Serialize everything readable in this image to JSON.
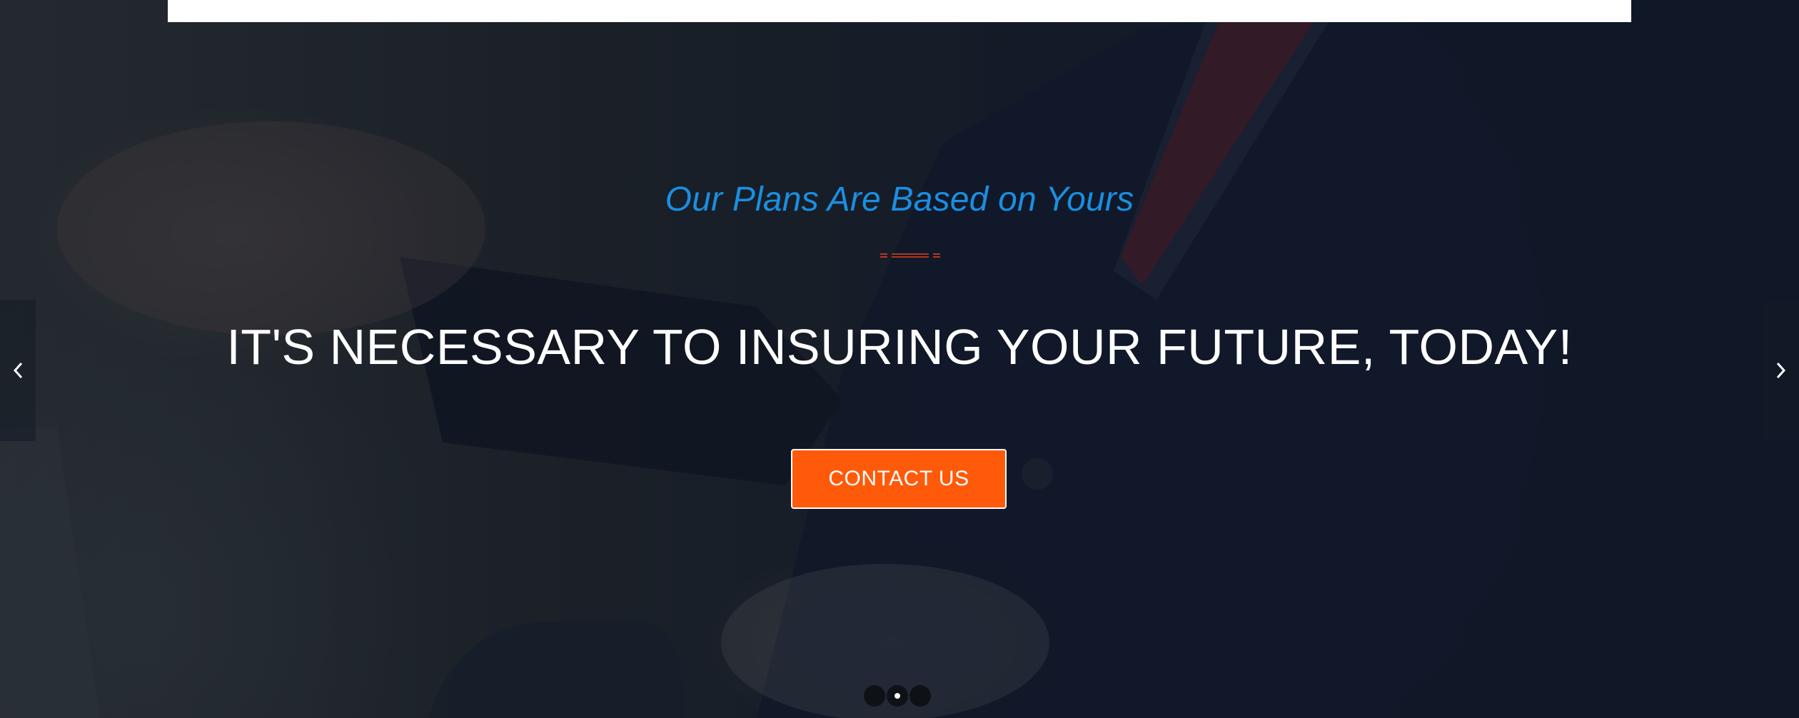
{
  "hero": {
    "subtitle": "Our Plans Are Based on Yours",
    "headline": "IT'S NECESSARY TO INSURING YOUR FUTURE, TODAY!",
    "cta_label": "CONTACT US"
  },
  "slider": {
    "prev_icon": "chevron-left-icon",
    "next_icon": "chevron-right-icon",
    "active_slide": 2,
    "slide_count": 3
  },
  "colors": {
    "accent_blue": "#1a8fe0",
    "accent_orange": "#ff5a0a",
    "divider_red": "#e2401c",
    "headline_text": "#ffffff"
  }
}
